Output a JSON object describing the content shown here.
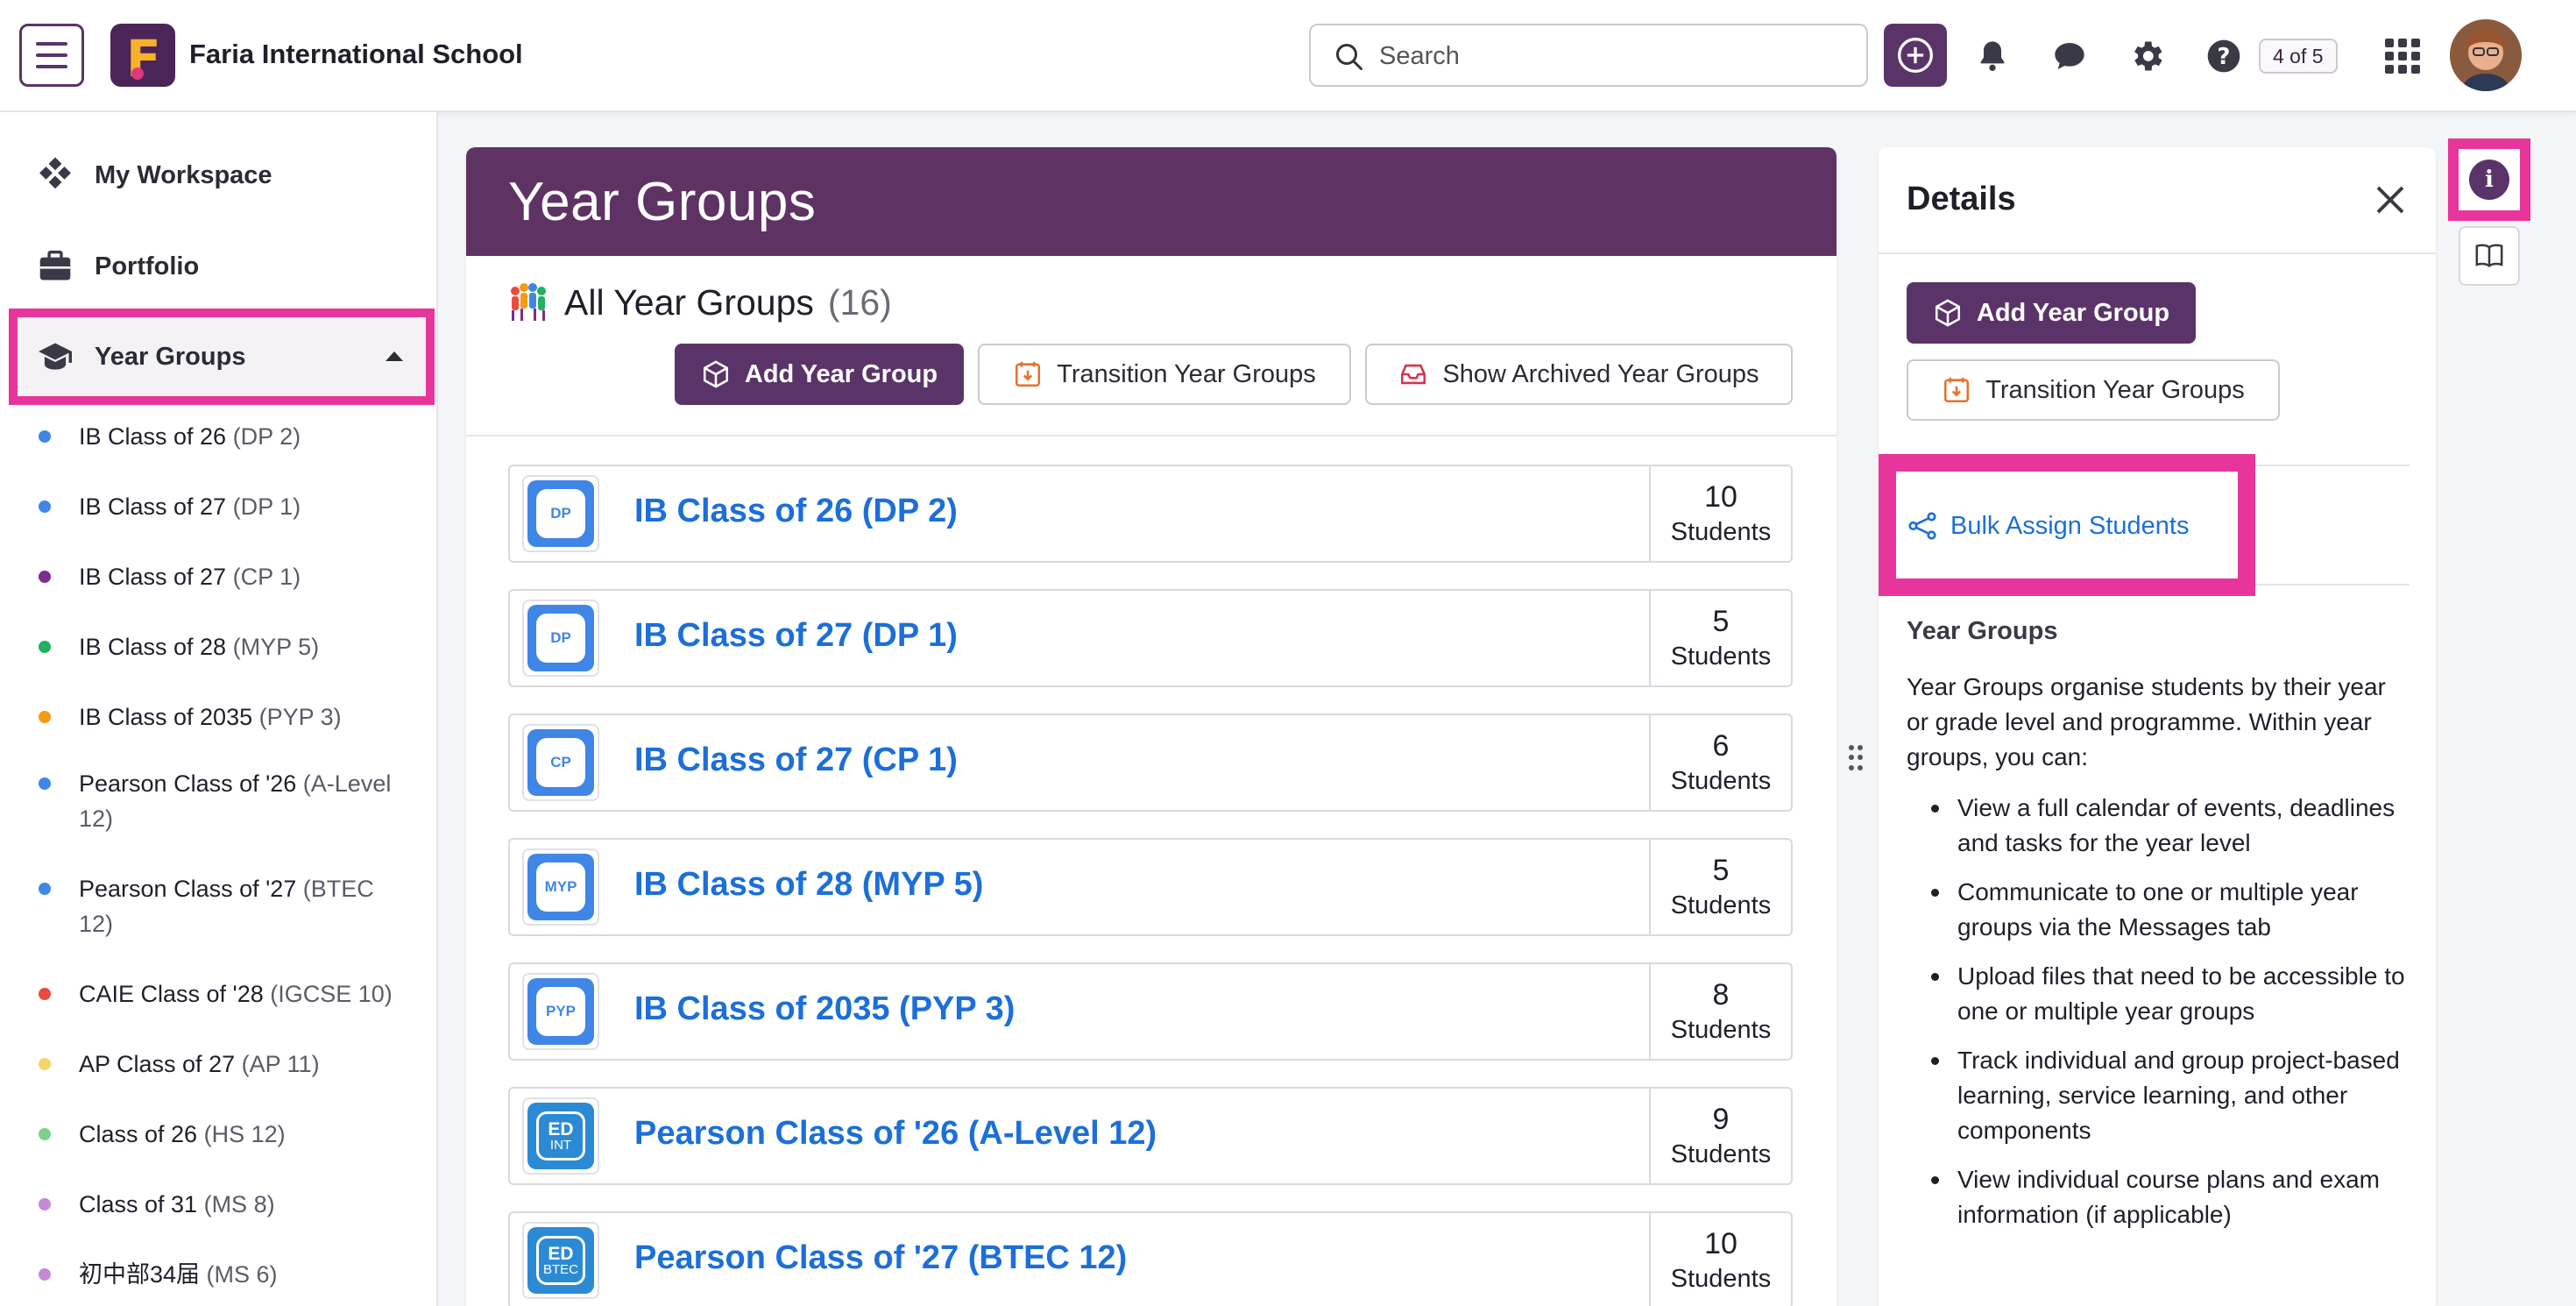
{
  "topbar": {
    "school_name": "Faria International School",
    "search_placeholder": "Search",
    "help_count": "4 of 5"
  },
  "sidebar": {
    "items": [
      {
        "label": "My Workspace",
        "icon": "workspace-icon"
      },
      {
        "label": "Portfolio",
        "icon": "briefcase-icon"
      },
      {
        "label": "Year Groups",
        "icon": "graduation-cap-icon"
      }
    ],
    "year_groups": [
      {
        "name": "IB Class of 26 ",
        "code": "(DP 2)",
        "color": "#3f86e6"
      },
      {
        "name": "IB Class of 27 ",
        "code": "(DP 1)",
        "color": "#3f86e6"
      },
      {
        "name": "IB Class of 27 ",
        "code": "(CP 1)",
        "color": "#7b2d8e"
      },
      {
        "name": "IB Class of 28 ",
        "code": "(MYP 5)",
        "color": "#20b060"
      },
      {
        "name": "IB Class of 2035 ",
        "code": "(PYP 3)",
        "color": "#f39c12"
      },
      {
        "name": "Pearson Class of '26 ",
        "code": "(A-Level 12)",
        "color": "#3f86e6"
      },
      {
        "name": "Pearson Class of '27 ",
        "code": "(BTEC 12)",
        "color": "#3f86e6"
      },
      {
        "name": "CAIE Class of '28 ",
        "code": "(IGCSE 10)",
        "color": "#e74c3c"
      },
      {
        "name": "AP Class of 27 ",
        "code": "(AP 11)",
        "color": "#f7d36b"
      },
      {
        "name": "Class of 26 ",
        "code": "(HS 12)",
        "color": "#7dd08a"
      },
      {
        "name": "Class of 31 ",
        "code": "(MS 8)",
        "color": "#c58ad6"
      },
      {
        "name": "初中部34届 ",
        "code": "(MS 6)",
        "color": "#c58ad6"
      }
    ]
  },
  "main": {
    "title": "Year Groups",
    "all_title": "All Year Groups",
    "all_count": "(16)",
    "buttons": {
      "add": "Add Year Group",
      "transition": "Transition Year Groups",
      "archived": "Show Archived Year Groups"
    },
    "rows": [
      {
        "badge": "DP",
        "type": "ib",
        "name": "IB Class of 26 (DP 2)",
        "count": "10",
        "unit": "Students"
      },
      {
        "badge": "DP",
        "type": "ib",
        "name": "IB Class of 27 (DP 1)",
        "count": "5",
        "unit": "Students"
      },
      {
        "badge": "CP",
        "type": "ib",
        "name": "IB Class of 27 (CP 1)",
        "count": "6",
        "unit": "Students"
      },
      {
        "badge": "MYP",
        "type": "ib",
        "name": "IB Class of 28 (MYP 5)",
        "count": "5",
        "unit": "Students"
      },
      {
        "badge": "PYP",
        "type": "ib",
        "name": "IB Class of 2035 (PYP 3)",
        "count": "8",
        "unit": "Students"
      },
      {
        "badge": "ED",
        "badge_sub": "INT",
        "type": "ed",
        "name": "Pearson Class of '26 (A-Level 12)",
        "count": "9",
        "unit": "Students"
      },
      {
        "badge": "ED",
        "badge_sub": "BTEC",
        "type": "ed",
        "name": "Pearson Class of '27 (BTEC 12)",
        "count": "10",
        "unit": "Students"
      }
    ]
  },
  "details": {
    "title": "Details",
    "add_label": "Add Year Group",
    "transition_label": "Transition Year Groups",
    "bulk_label": "Bulk Assign Students",
    "section_title": "Year Groups",
    "description": "Year Groups organise students by their year or grade level and programme. Within year groups, you can:",
    "bullets": [
      "View a full calendar of events, deadlines and tasks for the year level",
      "Communicate to one or multiple year groups via the Messages tab",
      "Upload files that need to be accessible to one or multiple year groups",
      "Track individual and group project-based learning, service learning, and other components",
      "View individual course plans and exam information (if applicable)"
    ]
  },
  "colors": {
    "brand_purple": "#5a3468",
    "header_purple": "#5e3364",
    "link_blue": "#1c6fd8",
    "highlight_pink": "#e8359c"
  }
}
